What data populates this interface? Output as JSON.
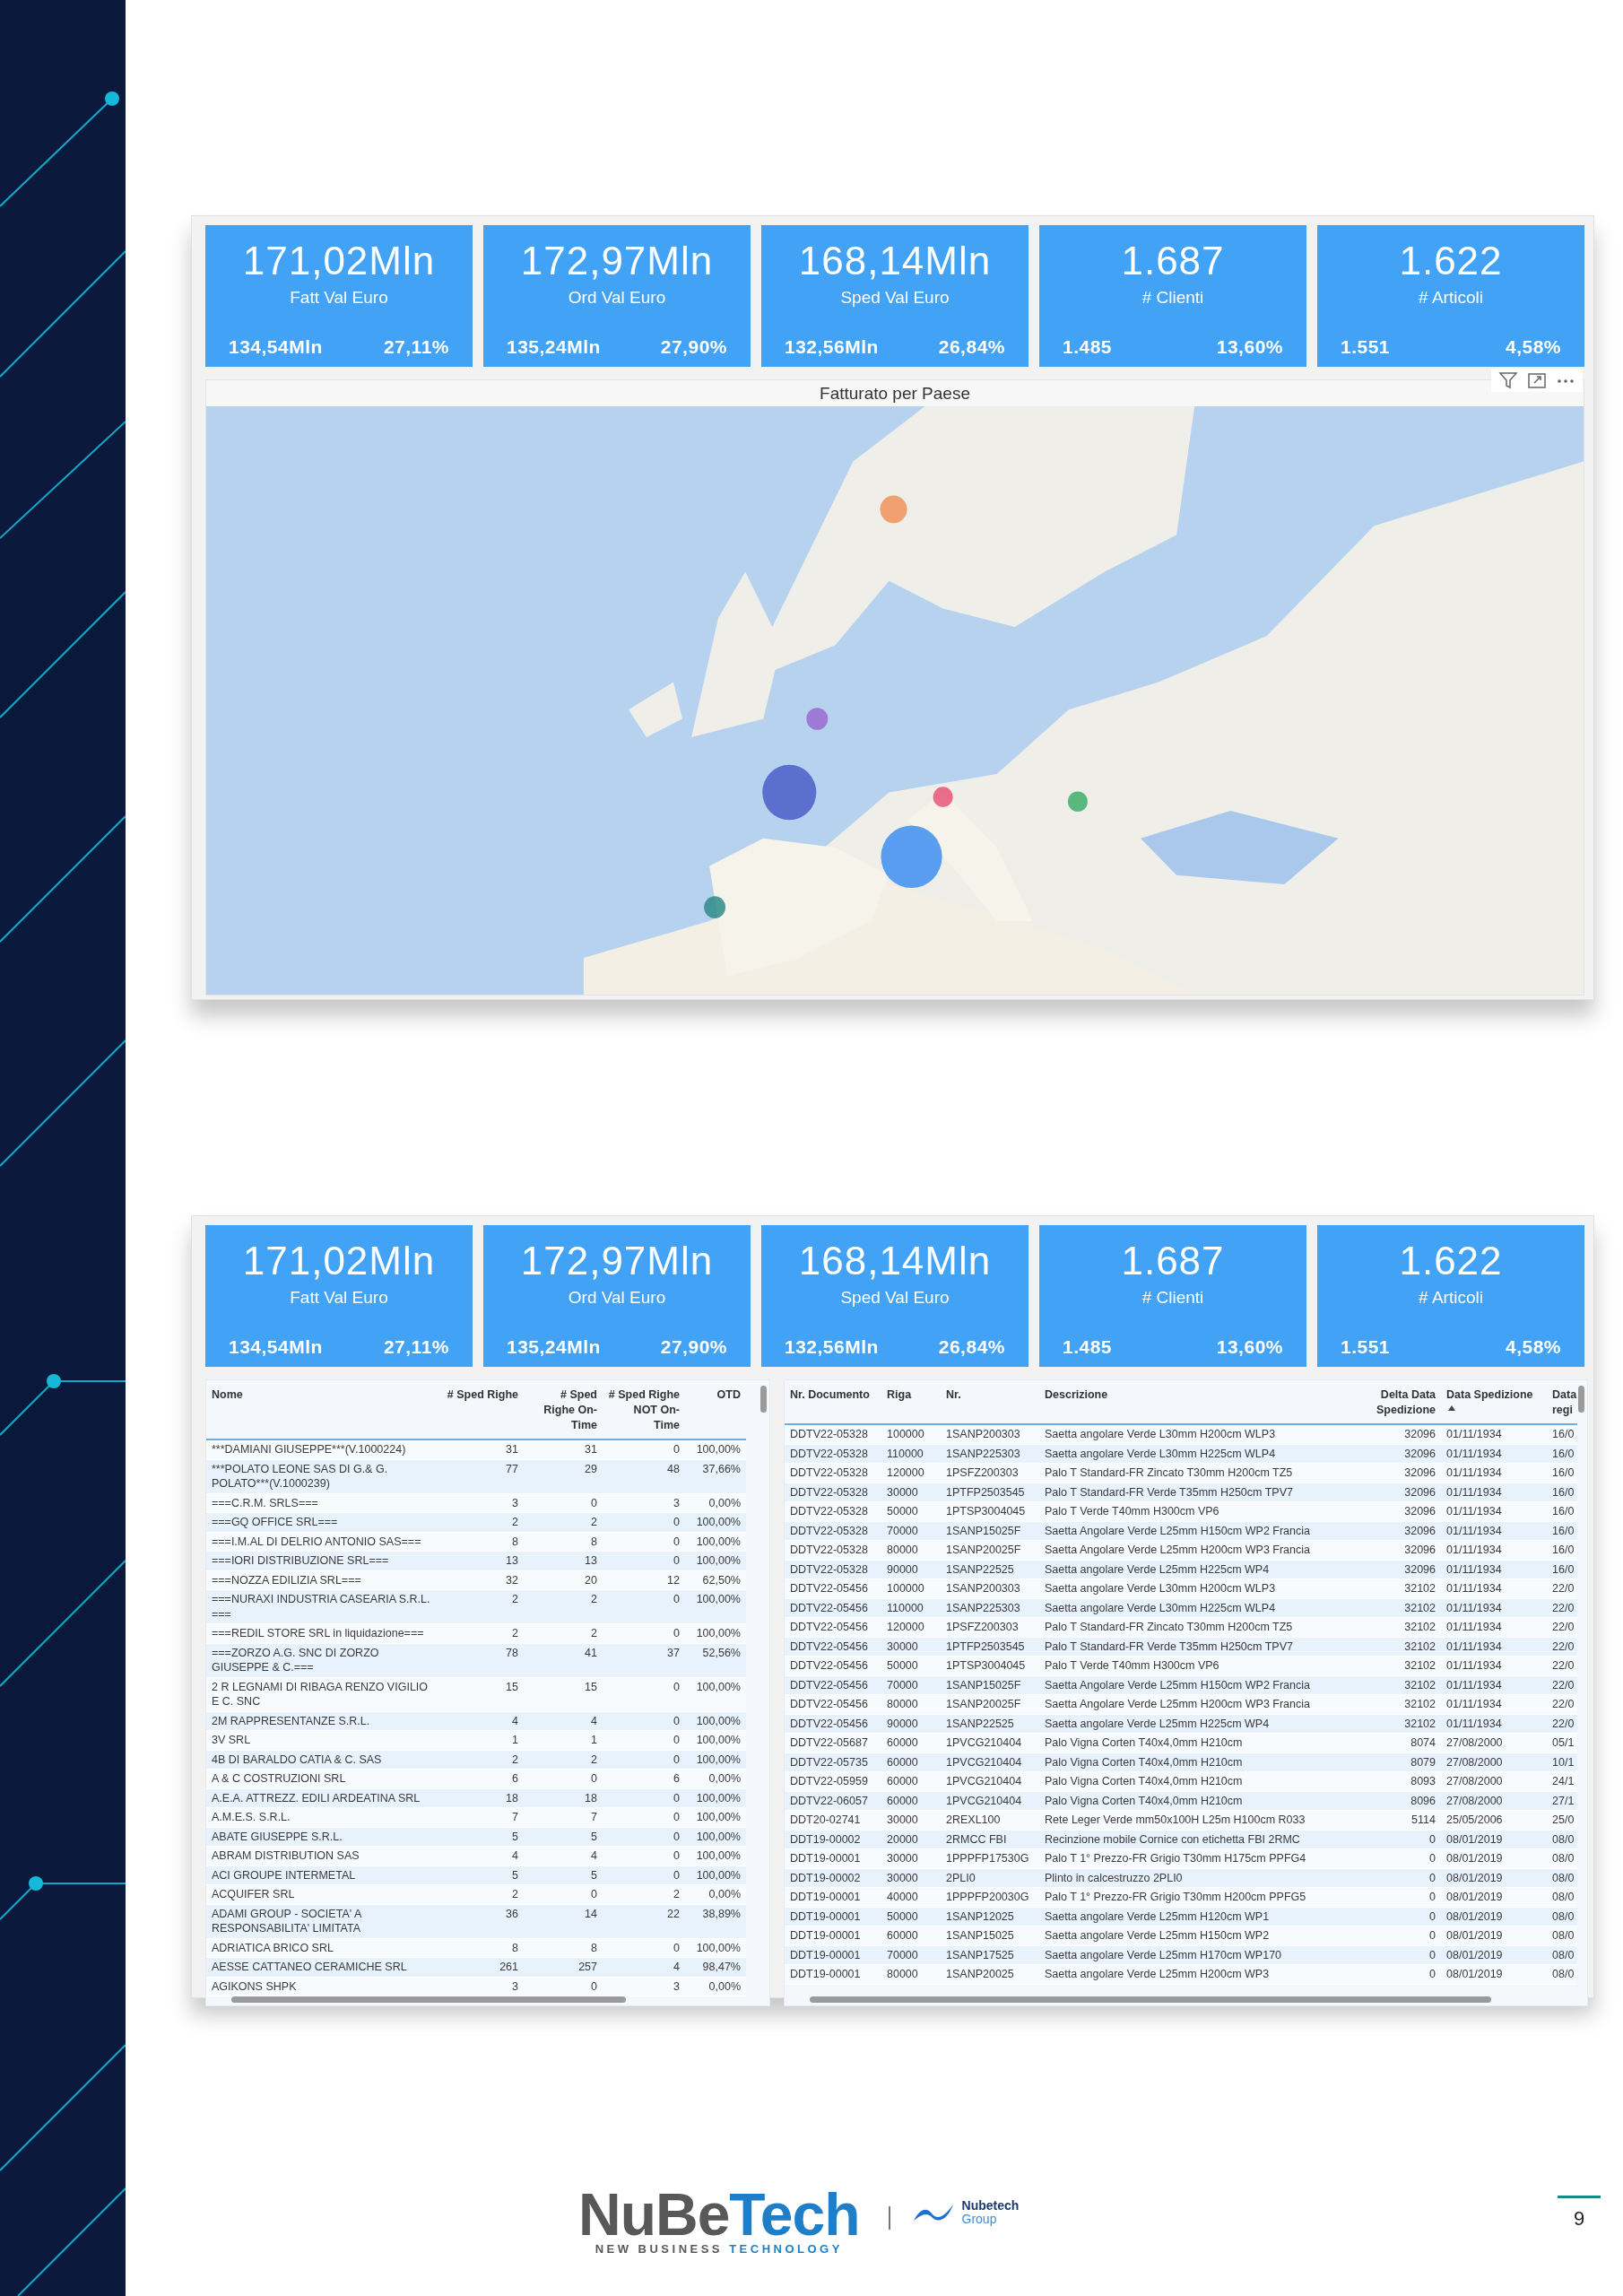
{
  "dashboards": [
    {
      "kpis": [
        {
          "value": "171,02Mln",
          "label": "Fatt Val Euro",
          "previous": "134,54Mln",
          "change": "27,11%"
        },
        {
          "value": "172,97Mln",
          "label": "Ord Val Euro",
          "previous": "135,24Mln",
          "change": "27,90%"
        },
        {
          "value": "168,14Mln",
          "label": "Sped Val Euro",
          "previous": "132,56Mln",
          "change": "26,84%"
        },
        {
          "value": "1.687",
          "label": "# Clienti",
          "previous": "1.485",
          "change": "13,60%"
        },
        {
          "value": "1.622",
          "label": "# Articoli",
          "previous": "1.551",
          "change": "4,58%"
        }
      ],
      "map": {
        "title": "Fatturato per Paese",
        "kind": "picture"
      }
    },
    {
      "kpis": [
        {
          "value": "171,02Mln",
          "label": "Fatt Val Euro",
          "previous": "134,54Mln",
          "change": "27,11%"
        },
        {
          "value": "172,97Mln",
          "label": "Ord Val Euro",
          "previous": "135,24Mln",
          "change": "27,90%"
        },
        {
          "value": "168,14Mln",
          "label": "Sped Val Euro",
          "previous": "132,56Mln",
          "change": "26,84%"
        },
        {
          "value": "1.687",
          "label": "# Clienti",
          "previous": "1.485",
          "change": "13,60%"
        },
        {
          "value": "1.622",
          "label": "# Articoli",
          "previous": "1.551",
          "change": "4,58%"
        }
      ],
      "tables": [
        {
          "columns": [
            {
              "label": "Nome"
            },
            {
              "label": "# Sped Righe"
            },
            {
              "label": "# Sped Righe On-Time"
            },
            {
              "label": "# Sped Righe NOT On-Time"
            },
            {
              "label": "OTD"
            }
          ],
          "rows": [
            [
              "***DAMIANI GIUSEPPE***(V.1000224)",
              "31",
              "31",
              "0",
              "100,00%"
            ],
            [
              "***POLATO LEONE SAS DI G.& G. POLATO***(V.1000239)",
              "77",
              "29",
              "48",
              "37,66%"
            ],
            [
              "===C.R.M. SRLS===",
              "3",
              "0",
              "3",
              "0,00%"
            ],
            [
              "===GQ OFFICE SRL===",
              "2",
              "2",
              "0",
              "100,00%"
            ],
            [
              "===I.M.AL DI DELRIO ANTONIO SAS===",
              "8",
              "8",
              "0",
              "100,00%"
            ],
            [
              "===IORI DISTRIBUZIONE SRL===",
              "13",
              "13",
              "0",
              "100,00%"
            ],
            [
              "===NOZZA EDILIZIA SRL===",
              "32",
              "20",
              "12",
              "62,50%"
            ],
            [
              "===NURAXI INDUSTRIA CASEARIA S.R.L. ===",
              "2",
              "2",
              "0",
              "100,00%"
            ],
            [
              "===REDIL STORE SRL in liquidazione===",
              "2",
              "2",
              "0",
              "100,00%"
            ],
            [
              "===ZORZO A.G. SNC DI ZORZO GIUSEPPE & C.===",
              "78",
              "41",
              "37",
              "52,56%"
            ],
            [
              "2 R LEGNAMI DI RIBAGA RENZO VIGILIO E C. SNC",
              "15",
              "15",
              "0",
              "100,00%"
            ],
            [
              "2M RAPPRESENTANZE S.R.L.",
              "4",
              "4",
              "0",
              "100,00%"
            ],
            [
              "3V SRL",
              "1",
              "1",
              "0",
              "100,00%"
            ],
            [
              "4B DI BARALDO CATIA & C. SAS",
              "2",
              "2",
              "0",
              "100,00%"
            ],
            [
              "A & C COSTRUZIONI SRL",
              "6",
              "0",
              "6",
              "0,00%"
            ],
            [
              "A.E.A. ATTREZZ. EDILI ARDEATINA SRL",
              "18",
              "18",
              "0",
              "100,00%"
            ],
            [
              "A.M.E.S. S.R.L.",
              "7",
              "7",
              "0",
              "100,00%"
            ],
            [
              "ABATE GIUSEPPE S.R.L.",
              "5",
              "5",
              "0",
              "100,00%"
            ],
            [
              "ABRAM DISTRIBUTION SAS",
              "4",
              "4",
              "0",
              "100,00%"
            ],
            [
              "ACI GROUPE INTERMETAL",
              "5",
              "5",
              "0",
              "100,00%"
            ],
            [
              "ACQUIFER SRL",
              "2",
              "0",
              "2",
              "0,00%"
            ],
            [
              "ADAMI GROUP - SOCIETA' A RESPONSABILITA' LIMITATA",
              "36",
              "14",
              "22",
              "38,89%"
            ],
            [
              "ADRIATICA BRICO SRL",
              "8",
              "8",
              "0",
              "100,00%"
            ],
            [
              "AESSE CATTANEO CERAMICHE SRL",
              "261",
              "257",
              "4",
              "98,47%"
            ],
            [
              "AGIKONS SHPK",
              "3",
              "0",
              "3",
              "0,00%"
            ]
          ]
        },
        {
          "columns": [
            {
              "label": "Nr. Documento",
              "sorted": false
            },
            {
              "label": "Riga",
              "sorted": false
            },
            {
              "label": "Nr.",
              "sorted": false
            },
            {
              "label": "Descrizione",
              "sorted": false
            },
            {
              "label": "Delta Data Spedizione",
              "sorted": false
            },
            {
              "label": "Data Spedizione",
              "sorted": true
            },
            {
              "label": "Data regi",
              "sorted": false
            }
          ],
          "rows": [
            [
              "DDTV22-05328",
              "100000",
              "1SANP200303",
              "Saetta angolare Verde L30mm H200cm WLP3",
              "32096",
              "01/11/1934",
              "16/0"
            ],
            [
              "DDTV22-05328",
              "110000",
              "1SANP225303",
              "Saetta angolare Verde L30mm H225cm WLP4",
              "32096",
              "01/11/1934",
              "16/0"
            ],
            [
              "DDTV22-05328",
              "120000",
              "1PSFZ200303",
              "Palo T Standard-FR Zincato T30mm H200cm TZ5",
              "32096",
              "01/11/1934",
              "16/0"
            ],
            [
              "DDTV22-05328",
              "30000",
              "1PTFP2503545",
              "Palo T Standard-FR Verde T35mm H250cm TPV7",
              "32096",
              "01/11/1934",
              "16/0"
            ],
            [
              "DDTV22-05328",
              "50000",
              "1PTSP3004045",
              "Palo T Verde T40mm H300cm VP6",
              "32096",
              "01/11/1934",
              "16/0"
            ],
            [
              "DDTV22-05328",
              "70000",
              "1SANP15025F",
              "Saetta Angolare Verde L25mm H150cm WP2 Francia",
              "32096",
              "01/11/1934",
              "16/0"
            ],
            [
              "DDTV22-05328",
              "80000",
              "1SANP20025F",
              "Saetta Angolare Verde L25mm H200cm WP3 Francia",
              "32096",
              "01/11/1934",
              "16/0"
            ],
            [
              "DDTV22-05328",
              "90000",
              "1SANP22525",
              "Saetta angolare Verde L25mm H225cm WP4",
              "32096",
              "01/11/1934",
              "16/0"
            ],
            [
              "DDTV22-05456",
              "100000",
              "1SANP200303",
              "Saetta angolare Verde L30mm H200cm WLP3",
              "32102",
              "01/11/1934",
              "22/0"
            ],
            [
              "DDTV22-05456",
              "110000",
              "1SANP225303",
              "Saetta angolare Verde L30mm H225cm WLP4",
              "32102",
              "01/11/1934",
              "22/0"
            ],
            [
              "DDTV22-05456",
              "120000",
              "1PSFZ200303",
              "Palo T Standard-FR Zincato T30mm H200cm TZ5",
              "32102",
              "01/11/1934",
              "22/0"
            ],
            [
              "DDTV22-05456",
              "30000",
              "1PTFP2503545",
              "Palo T Standard-FR Verde T35mm H250cm TPV7",
              "32102",
              "01/11/1934",
              "22/0"
            ],
            [
              "DDTV22-05456",
              "50000",
              "1PTSP3004045",
              "Palo T Verde T40mm H300cm VP6",
              "32102",
              "01/11/1934",
              "22/0"
            ],
            [
              "DDTV22-05456",
              "70000",
              "1SANP15025F",
              "Saetta Angolare Verde L25mm H150cm WP2 Francia",
              "32102",
              "01/11/1934",
              "22/0"
            ],
            [
              "DDTV22-05456",
              "80000",
              "1SANP20025F",
              "Saetta Angolare Verde L25mm H200cm WP3 Francia",
              "32102",
              "01/11/1934",
              "22/0"
            ],
            [
              "DDTV22-05456",
              "90000",
              "1SANP22525",
              "Saetta angolare Verde L25mm H225cm WP4",
              "32102",
              "01/11/1934",
              "22/0"
            ],
            [
              "DDTV22-05687",
              "60000",
              "1PVCG210404",
              "Palo Vigna Corten T40x4,0mm H210cm",
              "8074",
              "27/08/2000",
              "05/1"
            ],
            [
              "DDTV22-05735",
              "60000",
              "1PVCG210404",
              "Palo Vigna Corten T40x4,0mm H210cm",
              "8079",
              "27/08/2000",
              "10/1"
            ],
            [
              "DDTV22-05959",
              "60000",
              "1PVCG210404",
              "Palo Vigna Corten T40x4,0mm H210cm",
              "8093",
              "27/08/2000",
              "24/1"
            ],
            [
              "DDTV22-06057",
              "60000",
              "1PVCG210404",
              "Palo Vigna Corten T40x4,0mm H210cm",
              "8096",
              "27/08/2000",
              "27/1"
            ],
            [
              "DDT20-02741",
              "30000",
              "2REXL100",
              "Rete Leger Verde mm50x100H L25m H100cm R033",
              "5114",
              "25/05/2006",
              "25/0"
            ],
            [
              "DDT19-00002",
              "20000",
              "2RMCC FBI",
              "Recinzione mobile Cornice con etichetta FBI 2RMC",
              "0",
              "08/01/2019",
              "08/0"
            ],
            [
              "DDT19-00001",
              "30000",
              "1PPPFP17530G",
              "Palo T 1° Prezzo-FR Grigio T30mm H175cm PPFG4",
              "0",
              "08/01/2019",
              "08/0"
            ],
            [
              "DDT19-00002",
              "30000",
              "2PLI0",
              "Plinto in calcestruzzo 2PLI0",
              "0",
              "08/01/2019",
              "08/0"
            ],
            [
              "DDT19-00001",
              "40000",
              "1PPPFP20030G",
              "Palo T 1° Prezzo-FR Grigio T30mm H200cm PPFG5",
              "0",
              "08/01/2019",
              "08/0"
            ],
            [
              "DDT19-00001",
              "50000",
              "1SANP12025",
              "Saetta angolare Verde L25mm H120cm WP1",
              "0",
              "08/01/2019",
              "08/0"
            ],
            [
              "DDT19-00001",
              "60000",
              "1SANP15025",
              "Saetta angolare Verde L25mm H150cm WP2",
              "0",
              "08/01/2019",
              "08/0"
            ],
            [
              "DDT19-00001",
              "70000",
              "1SANP17525",
              "Saetta angolare Verde L25mm H170cm WP170",
              "0",
              "08/01/2019",
              "08/0"
            ],
            [
              "DDT19-00001",
              "80000",
              "1SANP20025",
              "Saetta angolare Verde L25mm H200cm WP3",
              "0",
              "08/01/2019",
              "08/0"
            ]
          ]
        }
      ]
    }
  ],
  "footer": {
    "logo": {
      "first": "NuBe",
      "second": "Tech",
      "tagline_first": "NEW BUSINESS",
      "tagline_second": "TECHNOLOGY"
    },
    "group": {
      "name": "Nubetech",
      "subtitle": "Group"
    },
    "page_number": "9"
  }
}
